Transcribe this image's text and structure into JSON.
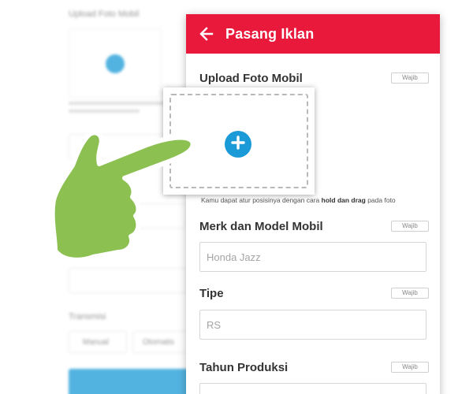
{
  "background_screen": {
    "upload_label": "Upload Foto Mobil",
    "transmisi_label": "Transmisi",
    "btn_manual": "Manual",
    "btn_otomatis": "Otomatis"
  },
  "appbar": {
    "title": "Pasang Iklan",
    "color": "#e8193a"
  },
  "form": {
    "required_badge": "Wajib",
    "upload": {
      "label": "Upload Foto Mobil",
      "hint_prefix": "Kamu dapat atur posisinya dengan cara ",
      "hint_bold": "hold dan drag",
      "hint_suffix": " pada foto"
    },
    "merk": {
      "label": "Merk dan Model Mobil",
      "placeholder": "Honda Jazz"
    },
    "tipe": {
      "label": "Tipe",
      "placeholder": "RS"
    },
    "tahun": {
      "label": "Tahun Produksi"
    }
  },
  "icons": {
    "back": "arrow-left-icon",
    "add_photo": "plus-icon",
    "pointer": "pointing-hand-icon"
  },
  "colors": {
    "accent": "#1a9ad6",
    "hand": "#8cc152"
  }
}
